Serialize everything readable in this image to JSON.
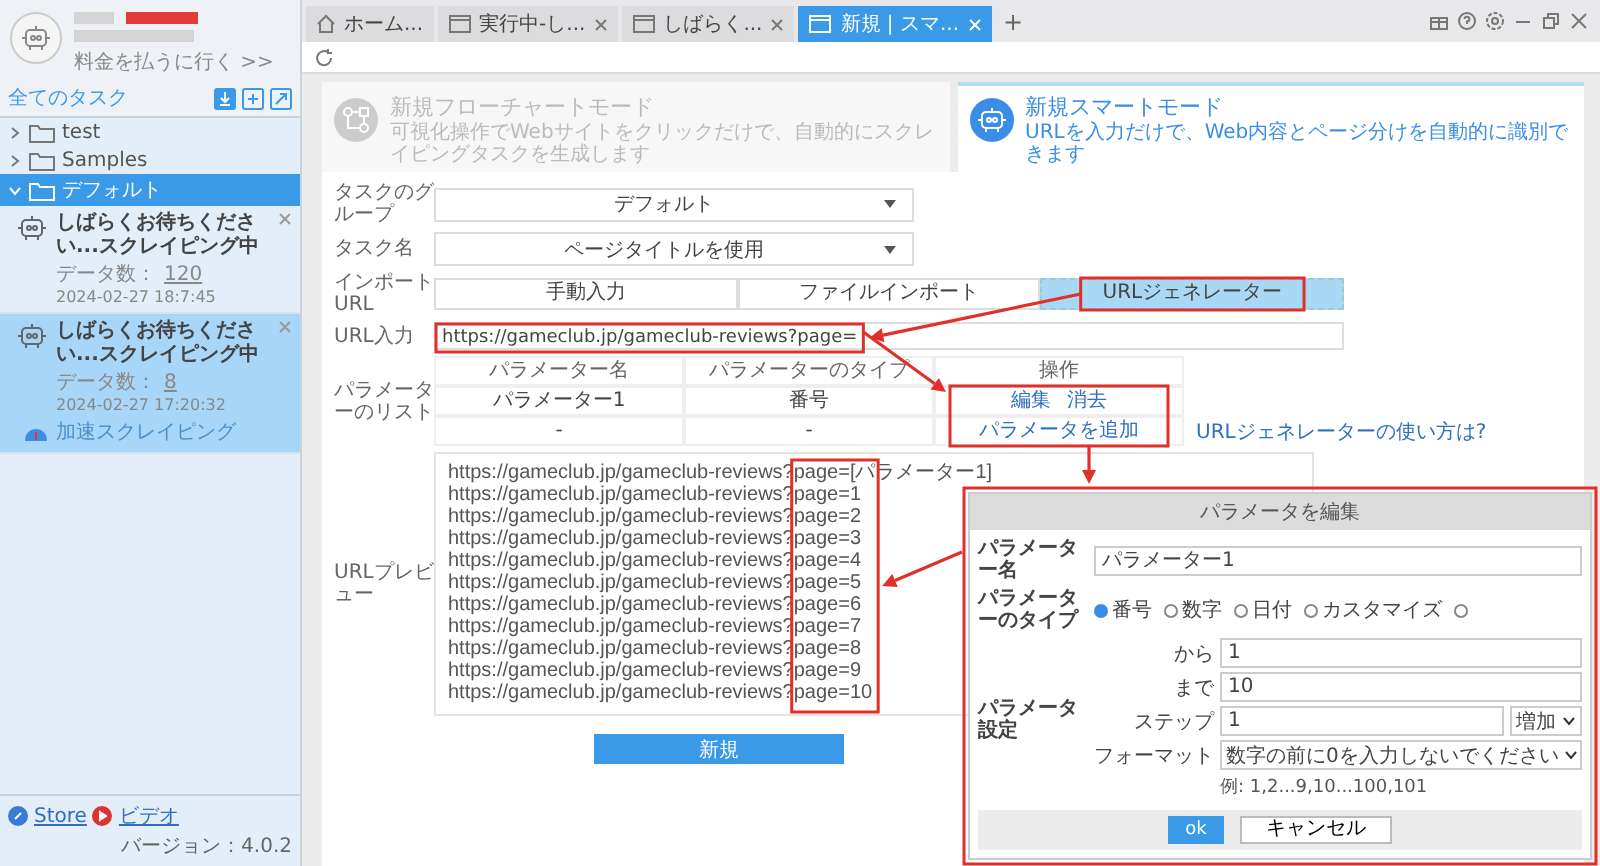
{
  "tab_bar": {
    "tabs": [
      {
        "label": "ホーム...",
        "kind": "home",
        "selected": false
      },
      {
        "label": "実行中-し...",
        "kind": "page",
        "selected": false
      },
      {
        "label": "しばらく...",
        "kind": "page",
        "selected": false
      },
      {
        "label": "新規 | スマ...",
        "kind": "page",
        "selected": true
      }
    ],
    "add_button": "+"
  },
  "sidebar": {
    "payment_link": "料金を払うに行く >>",
    "tasks_title": "全てのタスク",
    "folders": [
      {
        "name": "test",
        "expanded": false,
        "selected": false
      },
      {
        "name": "Samples",
        "expanded": false,
        "selected": false
      },
      {
        "name": "デフォルト",
        "expanded": true,
        "selected": true,
        "tasks": [
          {
            "title": "しばらくお待ちください...スクレイピング中",
            "count_label": "データ数：",
            "count": "120",
            "time": "2024-02-27 18:7:45",
            "selected": false
          },
          {
            "title": "しばらくお待ちください...スクレイピング中",
            "count_label": "データ数：",
            "count": "8",
            "time": "2024-02-27 17:20:32",
            "selected": true,
            "badge": "加速スクレイピング"
          }
        ]
      }
    ],
    "footer": {
      "store": "Store",
      "video": "ビデオ",
      "version": "バージョン：4.0.2"
    }
  },
  "mode_cards": [
    {
      "title": "新規フローチャートモード",
      "description": "可視化操作でWebサイトをクリックだけで、自動的にスクレイピングタスクを生成します",
      "selected": false
    },
    {
      "title": "新規スマートモード",
      "description": "URLを入力だけで、Web内容とページ分けを自動的に識別できます",
      "selected": true
    }
  ],
  "form": {
    "group": {
      "label": "タスクのグループ",
      "value": "デフォルト"
    },
    "task_name": {
      "label": "タスク名",
      "value": "ページタイトルを使用"
    },
    "import_url": {
      "label": "インポートURL",
      "options": [
        {
          "label": "手動入力",
          "selected": false
        },
        {
          "label": "ファイルインポート",
          "selected": false
        },
        {
          "label": "URLジェネレーター",
          "selected": true
        }
      ]
    },
    "url_input": {
      "label": "URL入力",
      "value": "https://gameclub.jp/gameclub-reviews?page="
    },
    "parameters": {
      "label": "パラメーターのリスト",
      "columns": [
        "パラメーター名",
        "パラメーターのタイプ",
        "操作"
      ],
      "rows": [
        {
          "name": "パラメーター1",
          "type": "番号",
          "actions": [
            "編集",
            "消去"
          ]
        }
      ],
      "add_row": {
        "name": "-",
        "type": "-",
        "action": "パラメータを追加"
      }
    },
    "help_link": "URLジェネレーターの使い方は?",
    "preview": {
      "label": "URLプレビュー",
      "lines": [
        "https://gameclub.jp/gameclub-reviews?page=[パラメーター1]",
        "https://gameclub.jp/gameclub-reviews?page=1",
        "https://gameclub.jp/gameclub-reviews?page=2",
        "https://gameclub.jp/gameclub-reviews?page=3",
        "https://gameclub.jp/gameclub-reviews?page=4",
        "https://gameclub.jp/gameclub-reviews?page=5",
        "https://gameclub.jp/gameclub-reviews?page=6",
        "https://gameclub.jp/gameclub-reviews?page=7",
        "https://gameclub.jp/gameclub-reviews?page=8",
        "https://gameclub.jp/gameclub-reviews?page=9",
        "https://gameclub.jp/gameclub-reviews?page=10"
      ]
    },
    "submit": "新規"
  },
  "dialog": {
    "title": "パラメータを編集",
    "name_label": "パラメーター名",
    "name_value": "パラメーター1",
    "type_label": "パラメーターのタイプ",
    "types": [
      {
        "label": "番号",
        "selected": true
      },
      {
        "label": "数字",
        "selected": false
      },
      {
        "label": "日付",
        "selected": false
      },
      {
        "label": "カスタマイズ",
        "selected": false
      },
      {
        "selected": false
      }
    ],
    "settings_label": "パラメータ設定",
    "from_label": "から",
    "from": "1",
    "to_label": "まで",
    "to": "10",
    "step_label": "ステップ",
    "step": "1",
    "step_mode": "増加",
    "format_label": "フォーマット",
    "format": "数字の前に0を入力しないでください",
    "example": "例: 1,2...9,10...100,101",
    "ok": "ok",
    "cancel": "キャンセル"
  }
}
